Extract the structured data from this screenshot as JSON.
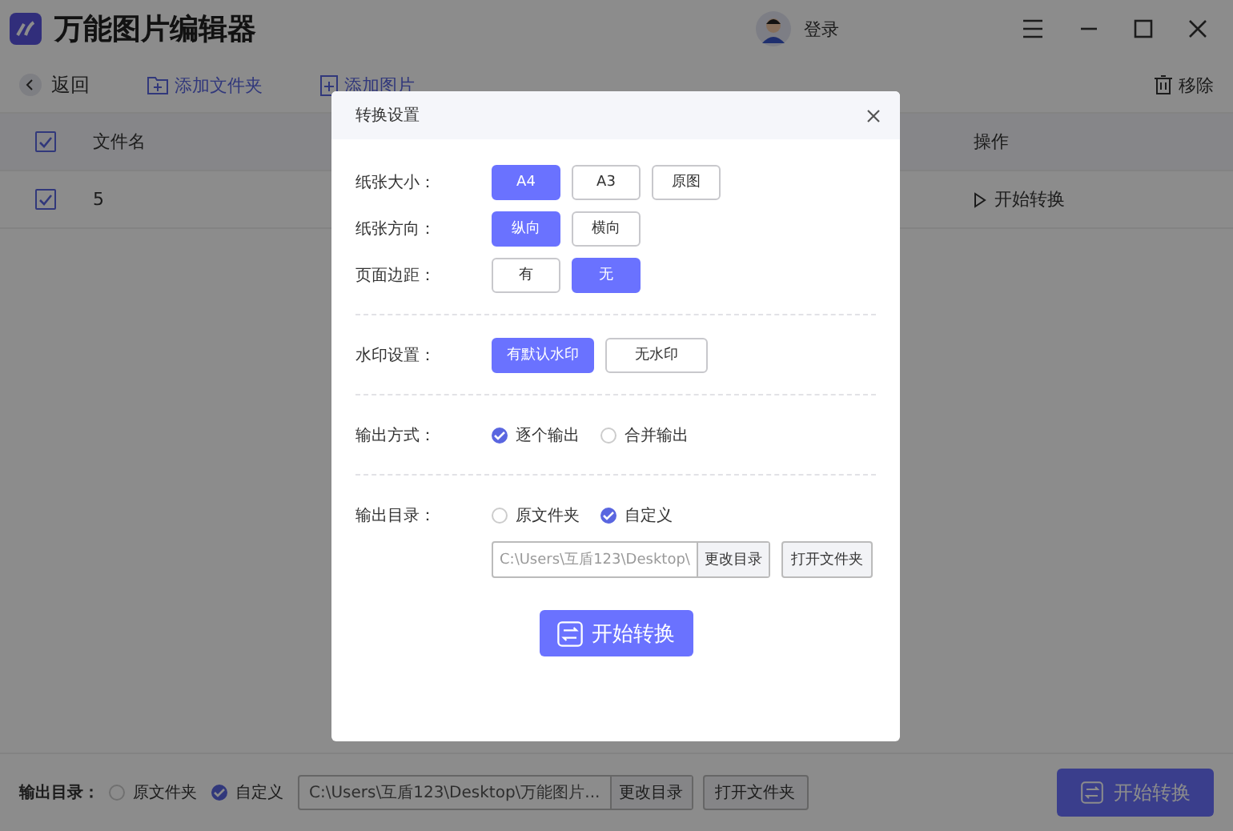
{
  "app": {
    "title": "万能图片编辑器",
    "login": "登录"
  },
  "toolbar": {
    "back": "返回",
    "add_folder": "添加文件夹",
    "add_image": "添加图片",
    "remove": "移除"
  },
  "table": {
    "header_checked": true,
    "columns": [
      "文件名",
      "操作"
    ],
    "rows": [
      {
        "checked": true,
        "name": "5",
        "action": "开始转换"
      }
    ]
  },
  "footer": {
    "label": "输出目录：",
    "options": [
      {
        "label": "原文件夹",
        "selected": false
      },
      {
        "label": "自定义",
        "selected": true
      }
    ],
    "path": "C:\\Users\\互盾123\\Desktop\\万能图片...",
    "change_dir": "更改目录",
    "open_folder": "打开文件夹",
    "start": "开始转换"
  },
  "dialog": {
    "title": "转换设置",
    "sections": [
      {
        "rows": [
          {
            "label": "纸张大小：",
            "kind": "buttons",
            "options": [
              {
                "label": "A4",
                "selected": true
              },
              {
                "label": "A3",
                "selected": false
              },
              {
                "label": "原图",
                "selected": false
              }
            ]
          },
          {
            "label": "纸张方向：",
            "kind": "buttons",
            "options": [
              {
                "label": "纵向",
                "selected": true
              },
              {
                "label": "横向",
                "selected": false
              }
            ]
          },
          {
            "label": "页面边距：",
            "kind": "buttons",
            "options": [
              {
                "label": "有",
                "selected": false
              },
              {
                "label": "无",
                "selected": true
              }
            ]
          }
        ]
      },
      {
        "rows": [
          {
            "label": "水印设置：",
            "kind": "wide-buttons",
            "options": [
              {
                "label": "有默认水印",
                "selected": true
              },
              {
                "label": "无水印",
                "selected": false
              }
            ]
          }
        ]
      },
      {
        "rows": [
          {
            "label": "输出方式：",
            "kind": "radio",
            "options": [
              {
                "label": "逐个输出",
                "selected": true
              },
              {
                "label": "合并输出",
                "selected": false
              }
            ]
          }
        ]
      },
      {
        "rows": [
          {
            "label": "输出目录：",
            "kind": "radio",
            "options": [
              {
                "label": "原文件夹",
                "selected": false
              },
              {
                "label": "自定义",
                "selected": true
              }
            ]
          }
        ]
      }
    ],
    "path": "C:\\Users\\互盾123\\Desktop\\",
    "change_dir": "更改目录",
    "open_folder": "打开文件夹",
    "start": "开始转换"
  }
}
